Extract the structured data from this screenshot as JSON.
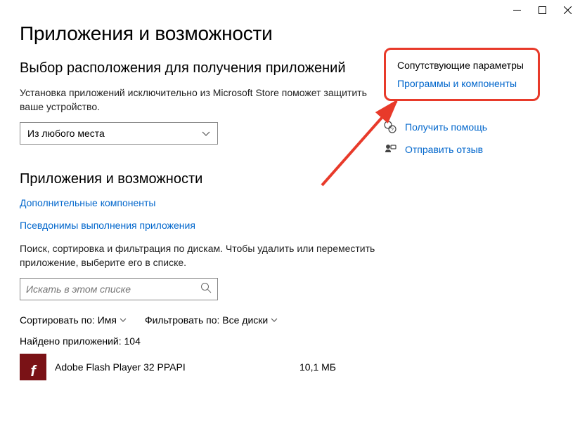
{
  "page_title": "Приложения и возможности",
  "section1": {
    "heading": "Выбор расположения для получения приложений",
    "desc": "Установка приложений исключительно из Microsoft Store поможет защитить ваше устройство.",
    "dropdown_value": "Из любого места"
  },
  "section2": {
    "heading": "Приложения и возможности",
    "link1": "Дополнительные компоненты",
    "link2": "Псевдонимы выполнения приложения",
    "hint": "Поиск, сортировка и фильтрация по дискам. Чтобы удалить или переместить приложение, выберите его в списке.",
    "search_placeholder": "Искать в этом списке",
    "sort_label": "Сортировать по:",
    "sort_value": "Имя",
    "filter_label": "Фильтровать по:",
    "filter_value": "Все диски",
    "count_label": "Найдено приложений: 104"
  },
  "app": {
    "name": "Adobe Flash Player 32 PPAPI",
    "size": "10,1 МБ"
  },
  "related": {
    "title": "Сопутствующие параметры",
    "link": "Программы и компоненты"
  },
  "help": {
    "get_help": "Получить помощь",
    "feedback": "Отправить отзыв"
  }
}
